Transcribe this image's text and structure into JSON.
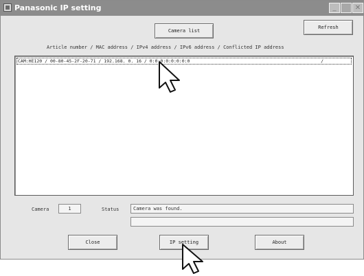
{
  "window": {
    "title": "Panasonic IP setting",
    "controls": {
      "minimize": "_",
      "maximize": "□",
      "close": "✕"
    }
  },
  "header": {
    "camera_list_label": "Camera list",
    "refresh_label": "Refresh",
    "columns_caption": "Article number / MAC address / IPv4 address / IPv6 address / Conflicted IP address"
  },
  "camera_list": {
    "items": [
      {
        "text": "CAM:HE120 / 00-80-45-2F-20-71 / 192.168.  0. 16 / 0:0:0:0:0:0:0:0",
        "trailing": "/"
      }
    ]
  },
  "status_row": {
    "camera_label": "Camera",
    "camera_count": "1",
    "status_label": "Status",
    "status_text": "Camera was found.",
    "status_text_2": ""
  },
  "footer": {
    "close_label": "Close",
    "ip_setting_label": "IP setting",
    "about_label": "About"
  },
  "cursors": [
    "pointer-cursor-list",
    "pointer-cursor-ip-setting"
  ]
}
